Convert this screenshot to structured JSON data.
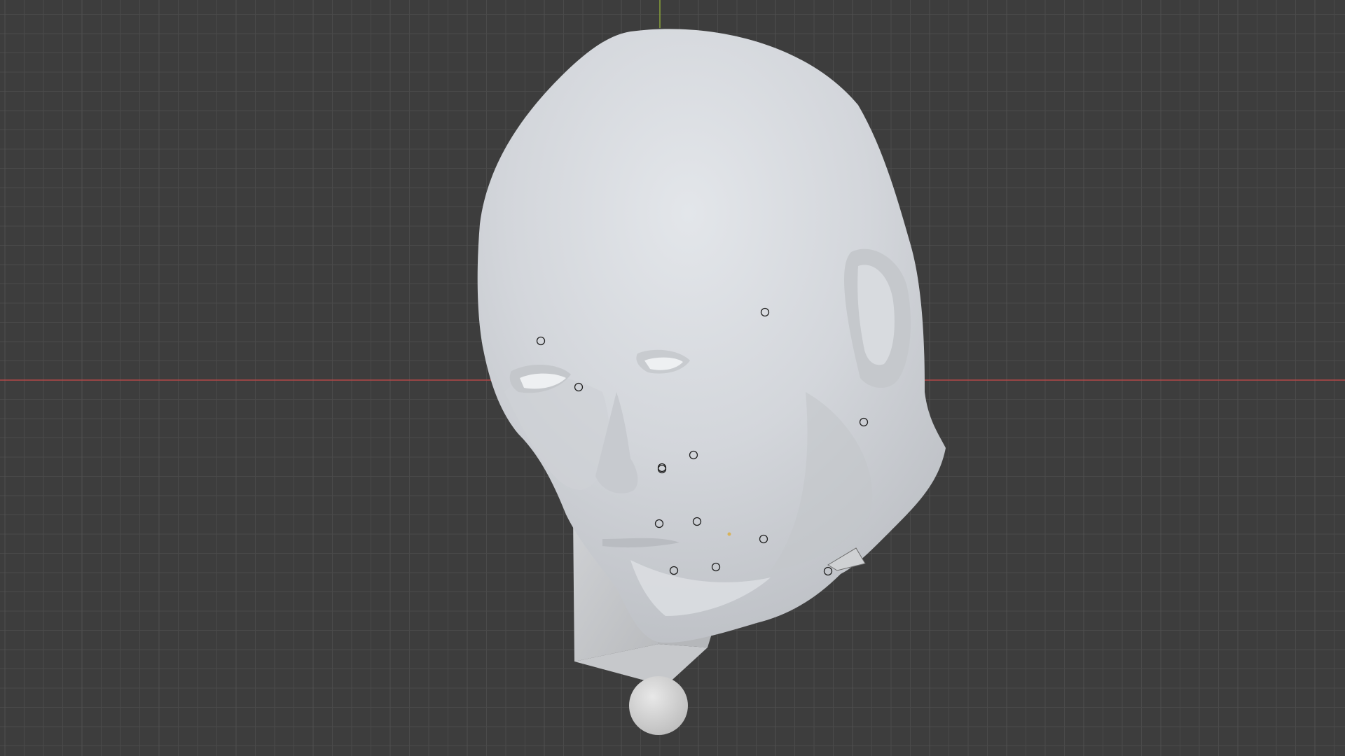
{
  "viewport": {
    "background": "#3d3d3d",
    "grid_minor_color": "#4a4a4a",
    "grid_major_color": "#505050",
    "x_axis_color": "#b34848",
    "y_axis_color": "#8aa33a"
  },
  "object": {
    "type": "head-mesh",
    "material_color": "#d7dade",
    "shade_color": "#b9bcc1",
    "light_color": "#eceff3"
  },
  "markers": {
    "empty_count": 12,
    "light_marker_color": "#d8b35a",
    "camera_marker": true
  }
}
